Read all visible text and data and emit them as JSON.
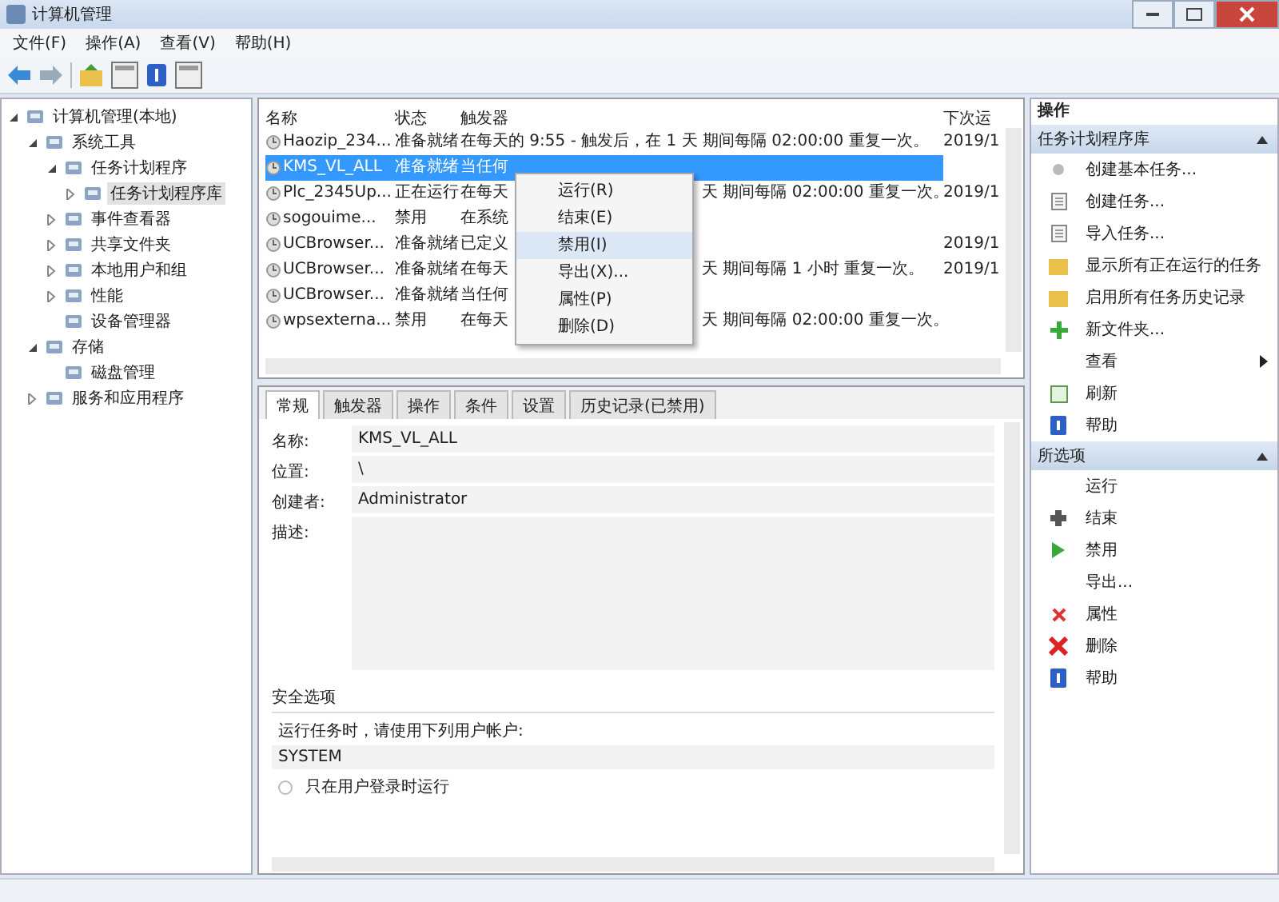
{
  "window": {
    "title": "计算机管理"
  },
  "menu": [
    "文件(F)",
    "操作(A)",
    "查看(V)",
    "帮助(H)"
  ],
  "tree": [
    {
      "label": "计算机管理(本地)",
      "expanded": true,
      "selected": false,
      "children": [
        {
          "label": "系统工具",
          "expanded": true,
          "selected": false,
          "children": [
            {
              "label": "任务计划程序",
              "expanded": true,
              "selected": false,
              "children": [
                {
                  "label": "任务计划程序库",
                  "expanded": false,
                  "selected": true
                }
              ]
            },
            {
              "label": "事件查看器",
              "expanded": false,
              "selected": false
            },
            {
              "label": "共享文件夹",
              "expanded": false,
              "selected": false
            },
            {
              "label": "本地用户和组",
              "expanded": false,
              "selected": false
            },
            {
              "label": "性能",
              "expanded": false,
              "selected": false
            },
            {
              "label": "设备管理器",
              "selected": false
            }
          ]
        },
        {
          "label": "存储",
          "expanded": true,
          "selected": false,
          "children": [
            {
              "label": "磁盘管理",
              "selected": false
            }
          ]
        },
        {
          "label": "服务和应用程序",
          "expanded": false,
          "selected": false
        }
      ]
    }
  ],
  "table": {
    "columns": [
      "名称",
      "状态",
      "触发器",
      "下次运"
    ],
    "rows": [
      {
        "name": "Haozip_234...",
        "status": "准备就绪",
        "trigger": "在每天的 9:55 - 触发后，在 1 天 期间每隔 02:00:00 重复一次。",
        "next": "2019/1",
        "selected": false
      },
      {
        "name": "KMS_VL_ALL",
        "status": "准备就绪",
        "trigger": "当任何",
        "selected": true
      },
      {
        "name": "Plc_2345Up...",
        "status": "正在运行",
        "trigger": "在每天",
        "trigger_tail": "天 期间每隔 02:00:00 重复一次。",
        "next": "2019/1",
        "selected": false
      },
      {
        "name": "sogouime...",
        "status": "禁用",
        "trigger": "在系统",
        "selected": false
      },
      {
        "name": "UCBrowser...",
        "status": "准备就绪",
        "trigger": "已定义",
        "next": "2019/1",
        "selected": false
      },
      {
        "name": "UCBrowser...",
        "status": "准备就绪",
        "trigger": "在每天",
        "trigger_tail": "天 期间每隔 1 小时 重复一次。",
        "next": "2019/1",
        "selected": false
      },
      {
        "name": "UCBrowser...",
        "status": "准备就绪",
        "trigger": "当任何",
        "selected": false
      },
      {
        "name": "wpsexterna...",
        "status": "禁用",
        "trigger": "在每天",
        "trigger_tail": "天 期间每隔 02:00:00 重复一次。",
        "selected": false
      }
    ]
  },
  "context_menu": [
    {
      "label": "运行(R)",
      "selected": false
    },
    {
      "label": "结束(E)",
      "selected": false
    },
    {
      "label": "禁用(I)",
      "selected": true
    },
    {
      "label": "导出(X)...",
      "selected": false
    },
    {
      "label": "属性(P)",
      "selected": false
    },
    {
      "label": "删除(D)",
      "selected": false
    }
  ],
  "tabs": [
    {
      "label": "常规",
      "selected": true
    },
    {
      "label": "触发器",
      "selected": false
    },
    {
      "label": "操作",
      "selected": false
    },
    {
      "label": "条件",
      "selected": false
    },
    {
      "label": "设置",
      "selected": false
    },
    {
      "label": "历史记录(已禁用)",
      "selected": false
    }
  ],
  "general": {
    "fields": [
      {
        "label": "名称:",
        "value": "KMS_VL_ALL"
      },
      {
        "label": "位置:",
        "value": "\\"
      },
      {
        "label": "创建者:",
        "value": "Administrator"
      },
      {
        "label": "描述:",
        "kind": "area"
      }
    ],
    "security_title": "安全选项",
    "security_text": "运行任务时，请使用下列用户帐户:",
    "account": "SYSTEM",
    "radio": {
      "label": "只在用户登录时运行",
      "selected": false
    }
  },
  "actions": {
    "title": "操作",
    "sections": [
      {
        "title": "任务计划程序库",
        "items": [
          {
            "label": "创建基本任务..."
          },
          {
            "label": "创建任务..."
          },
          {
            "label": "导入任务..."
          },
          {
            "label": "显示所有正在运行的任务"
          },
          {
            "label": "启用所有任务历史记录"
          },
          {
            "label": "新文件夹..."
          },
          {
            "label": "查看",
            "submenu": true
          },
          {
            "label": "刷新"
          },
          {
            "label": "帮助"
          }
        ]
      },
      {
        "title": "所选项",
        "items": [
          {
            "label": "运行"
          },
          {
            "label": "结束"
          },
          {
            "label": "禁用"
          },
          {
            "label": "导出..."
          },
          {
            "label": "属性"
          },
          {
            "label": "删除"
          },
          {
            "label": "帮助"
          }
        ]
      }
    ]
  }
}
